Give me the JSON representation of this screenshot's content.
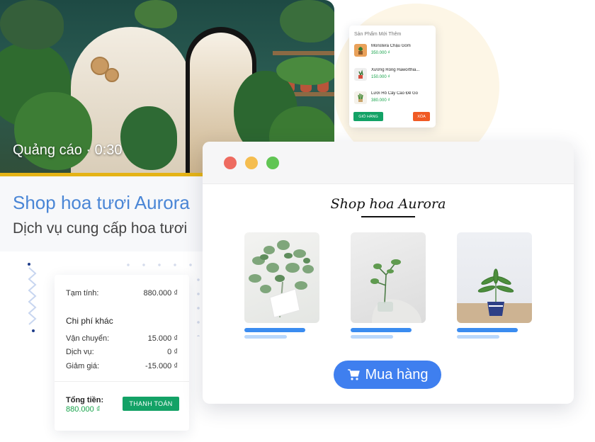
{
  "ad": {
    "label": "Quảng cáo · 0:30",
    "shop_name": "Shop hoa tươi Aurora",
    "shop_description": "Dịch vụ cung cấp hoa tươi",
    "progress": 1.0
  },
  "order_summary": {
    "subtotal_label": "Tạm tính:",
    "subtotal_value": "880.000 ₫",
    "other_fees_heading": "Chi phí khác",
    "fees": [
      {
        "label": "Vận chuyển:",
        "value": "15.000 ₫"
      },
      {
        "label": "Dịch vụ:",
        "value": "0 ₫"
      },
      {
        "label": "Giảm giá:",
        "value": "-15.000 ₫"
      }
    ],
    "total_label": "Tổng tiền:",
    "total_value": "880.000 ₫",
    "pay_button": "THANH TOÁN"
  },
  "new_products": {
    "title": "Sản Phẩm Mới Thêm",
    "items": [
      {
        "name": "Monstera Chậu Gốm",
        "price": "350.000 ₫"
      },
      {
        "name": "Xương Rồng Haworthia...",
        "price": "150.000 ₫"
      },
      {
        "name": "Lưỡi Hổ Cây Cao Để Gỗ",
        "price": "380.000 ₫"
      }
    ],
    "cart_button": "GIỎ HÀNG",
    "delete_button": "XÓA"
  },
  "browser": {
    "site_logo": "Shop hoa Aurora",
    "buy_button": "Mua hàng"
  },
  "colors": {
    "accent_blue": "#3f7fef",
    "shop_name_blue": "#4a86d6",
    "pay_green": "#13a266",
    "delete_orange": "#f05a24",
    "progress_yellow": "#e5b315"
  }
}
